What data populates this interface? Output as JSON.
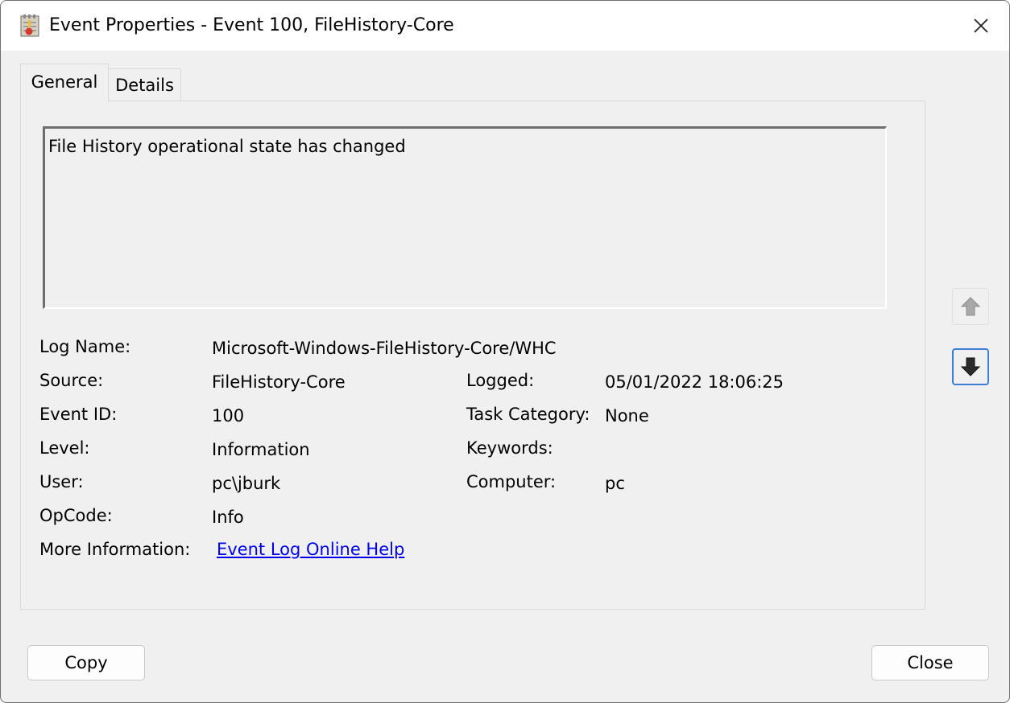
{
  "window": {
    "title": "Event Properties - Event 100, FileHistory-Core",
    "icon": "event-viewer-icon"
  },
  "tabs": [
    {
      "label": "General",
      "active": true
    },
    {
      "label": "Details",
      "active": false
    }
  ],
  "description": "File History operational state has changed",
  "fields": {
    "log_name": {
      "label": "Log Name:",
      "value": "Microsoft-Windows-FileHistory-Core/WHC"
    },
    "source": {
      "label": "Source:",
      "value": "FileHistory-Core"
    },
    "logged": {
      "label": "Logged:",
      "value": "05/01/2022 18:06:25"
    },
    "event_id": {
      "label": "Event ID:",
      "value": "100"
    },
    "task_category": {
      "label": "Task Category:",
      "value": "None"
    },
    "level": {
      "label": "Level:",
      "value": "Information"
    },
    "keywords": {
      "label": "Keywords:",
      "value": ""
    },
    "user": {
      "label": "User:",
      "value": "pc\\jburk"
    },
    "computer": {
      "label": "Computer:",
      "value": "pc"
    },
    "opcode": {
      "label": "OpCode:",
      "value": "Info"
    },
    "more_info": {
      "label": "More Information:",
      "link_text": "Event Log Online Help"
    }
  },
  "nav": {
    "up_icon": "arrow-up-icon",
    "down_icon": "arrow-down-icon"
  },
  "buttons": {
    "copy": "Copy",
    "close": "Close"
  },
  "colors": {
    "link": "#0000ee",
    "focus_border": "#3c7fd8",
    "window_bg": "#f0f0f0"
  }
}
